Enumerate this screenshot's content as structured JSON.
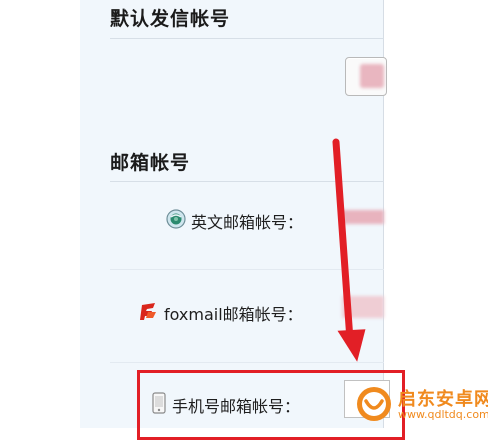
{
  "sections": {
    "default_sender": {
      "title": "默认发信帐号"
    },
    "mail_accounts": {
      "title": "邮箱帐号"
    }
  },
  "rows": {
    "english_account": {
      "label": "英文邮箱帐号：",
      "icon": "globe-icon"
    },
    "foxmail_account": {
      "label": "foxmail邮箱帐号：",
      "icon": "foxmail-logo-icon"
    },
    "mobile_account": {
      "label": "手机号邮箱帐号：",
      "icon": "phone-icon"
    }
  },
  "watermark": {
    "text_cn": "启东安卓网",
    "url": "www.qdltdq.com"
  },
  "colors": {
    "highlight": "#e21f26",
    "panel_bg": "#f1f7fc",
    "watermark": "#f08a1e"
  }
}
